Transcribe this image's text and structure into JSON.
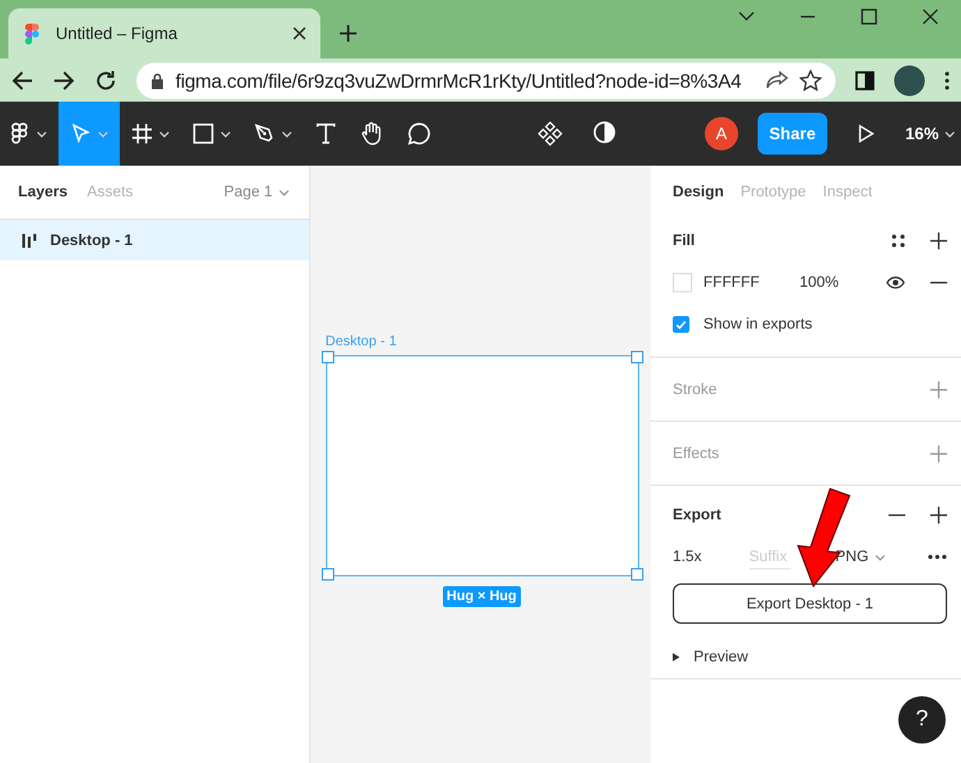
{
  "browser": {
    "tab_title": "Untitled – Figma",
    "url": "figma.com/file/6r9zq3vuZwDrmrMcR1rKty/Untitled?node-id=8%3A4"
  },
  "toolbar": {
    "tools": [
      {
        "kind": "menu",
        "selected": false
      },
      {
        "kind": "move",
        "selected": true
      },
      {
        "kind": "frame",
        "selected": false
      },
      {
        "kind": "shape",
        "selected": false
      },
      {
        "kind": "pen",
        "selected": false
      },
      {
        "kind": "text",
        "selected": false
      },
      {
        "kind": "hand",
        "selected": false
      },
      {
        "kind": "comment",
        "selected": false
      }
    ],
    "avatar": "A",
    "share": "Share",
    "zoom": "16%"
  },
  "left_panel": {
    "tabs": [
      {
        "label": "Layers",
        "selected": true
      },
      {
        "label": "Assets",
        "selected": false
      }
    ],
    "page": "Page 1",
    "layers": [
      {
        "name": "Desktop - 1",
        "selected": true
      }
    ]
  },
  "canvas": {
    "frame_label": "Desktop - 1",
    "size_badge": "Hug × Hug"
  },
  "right_panel": {
    "tabs": [
      {
        "label": "Design",
        "selected": true
      },
      {
        "label": "Prototype",
        "selected": false
      },
      {
        "label": "Inspect",
        "selected": false
      }
    ],
    "fill": {
      "title": "Fill",
      "hex": "FFFFFF",
      "opacity": "100%",
      "show_in_exports": {
        "label": "Show in exports",
        "checked": true
      }
    },
    "sections": [
      {
        "title": "Stroke"
      },
      {
        "title": "Effects"
      }
    ],
    "export": {
      "title": "Export",
      "scale": "1.5x",
      "suffix_placeholder": "Suffix",
      "format": "PNG",
      "button": "Export Desktop - 1",
      "preview": "Preview"
    },
    "help": "?"
  }
}
